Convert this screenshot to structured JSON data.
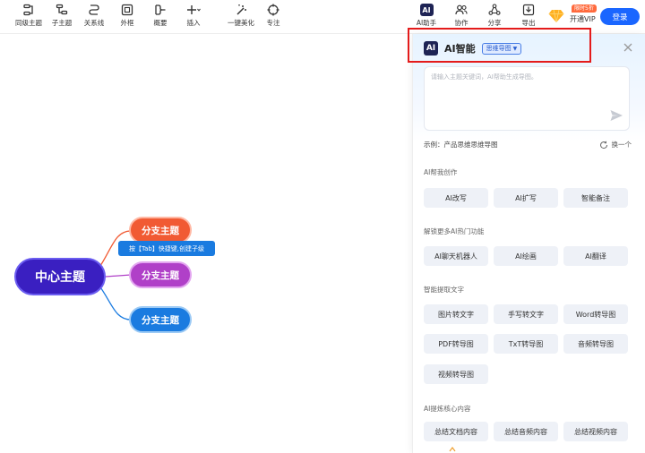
{
  "toolbar": {
    "items": [
      {
        "label": "同级主题",
        "icon": "sibling-topic-icon"
      },
      {
        "label": "子主题",
        "icon": "child-topic-icon"
      },
      {
        "label": "关系线",
        "icon": "relation-line-icon"
      },
      {
        "label": "外框",
        "icon": "frame-icon"
      },
      {
        "label": "概要",
        "icon": "summary-icon"
      },
      {
        "label": "插入",
        "icon": "plus-icon"
      },
      {
        "label": "一键美化",
        "icon": "magic-wand-icon"
      },
      {
        "label": "专注",
        "icon": "focus-icon"
      },
      {
        "label": "AI助手",
        "icon": "ai-badge-icon",
        "badge": "AI"
      },
      {
        "label": "协作",
        "icon": "collaborate-icon"
      },
      {
        "label": "分享",
        "icon": "share-icon"
      },
      {
        "label": "导出",
        "icon": "export-icon"
      }
    ],
    "vip_tag": "限时5折",
    "vip_label": "开通VIP",
    "login_label": "登录"
  },
  "mindmap": {
    "center": "中心主题",
    "branches": [
      "分支主题",
      "分支主题",
      "分支主题"
    ],
    "tooltip": "按【Tab】快捷键,创建子级",
    "colors": {
      "center": "#3a1fc1",
      "branch1": "#f15a33",
      "branch2": "#b040c8",
      "branch3": "#1a7be0"
    }
  },
  "ai_panel": {
    "logo": "AI",
    "title": "AI智能",
    "mode": "思维导图",
    "prompt_placeholder": "请输入主题关键词，AI帮助生成导图。",
    "example": "示例：产品思维思维导图",
    "refresh_label": "换一个",
    "sections": [
      {
        "title": "AI帮我创作",
        "chips": [
          "AI改写",
          "AI扩写",
          "智能备注"
        ]
      },
      {
        "title": "解锁更多AI热门功能",
        "chips": [
          "AI聊天机器人",
          "AI绘画",
          "AI翻译"
        ]
      },
      {
        "title": "智能提取文字",
        "chips": [
          "图片转文字",
          "手写转文字",
          "Word转导图",
          "PDF转导图",
          "TxT转导图",
          "音频转导图",
          "视频转导图"
        ]
      },
      {
        "title": "AI提炼核心内容",
        "chips": [
          "总结文档内容",
          "总结音频内容",
          "总结视频内容"
        ]
      }
    ]
  }
}
